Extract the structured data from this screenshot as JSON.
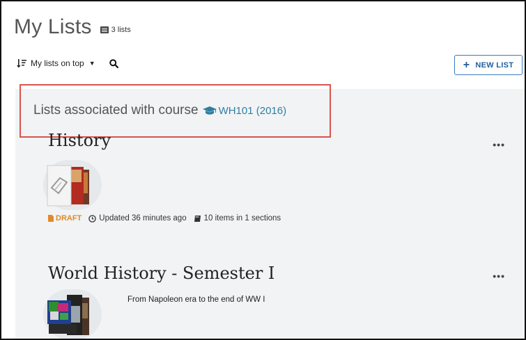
{
  "header": {
    "title": "My Lists",
    "count": "3 lists"
  },
  "toolbar": {
    "sort_label": "My lists on top",
    "new_list_label": "NEW LIST"
  },
  "course_group": {
    "label": "Lists associated with course",
    "course": "WH101 (2016)"
  },
  "lists": [
    {
      "title": "History",
      "status": "DRAFT",
      "updated": "Updated 36 minutes ago",
      "items": "10 items in 1 sections"
    },
    {
      "title": "World History - Semester I",
      "description": "From Napoleon era to the end of WW I"
    }
  ],
  "icons": {
    "sort": "sort-icon",
    "search": "search-icon",
    "graduation_cap": "graduation-cap-icon",
    "clock": "clock-icon",
    "book": "book-icon",
    "draft": "file-icon",
    "more": "more-options-icon"
  },
  "colors": {
    "accent_blue": "#1f5f9f",
    "course_link": "#2f7ea4",
    "draft_orange": "#e08a2c",
    "highlight_red": "#d9534f"
  }
}
